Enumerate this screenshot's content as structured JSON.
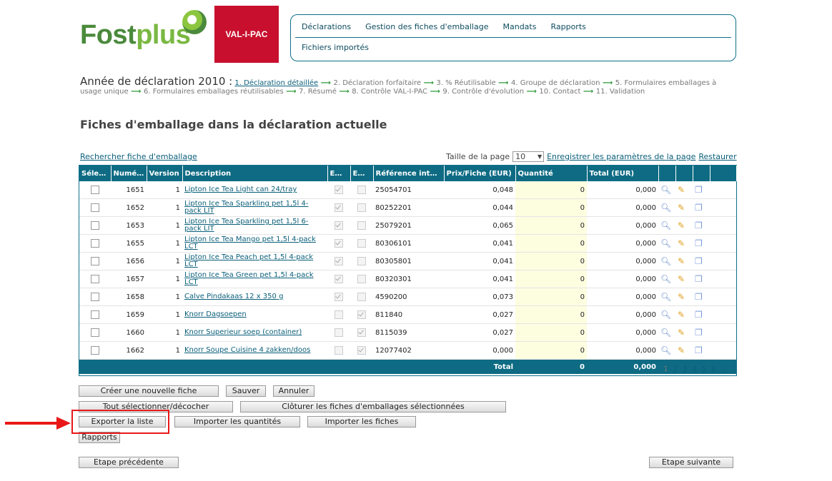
{
  "header": {
    "logo_text_a": "Fost",
    "logo_text_b": "plus",
    "partner_logo": "VAL-I-PAC"
  },
  "nav": {
    "items": [
      "Déclarations",
      "Gestion des fiches d'emballage",
      "Mandats",
      "Rapports"
    ],
    "sub_item": "Fichiers importés"
  },
  "breadcrumb": {
    "year_label": "Année de déclaration 2010 :",
    "steps": [
      "1. Déclaration détaillée",
      "2. Déclaration forfaitaire",
      "3. % Réutilisable",
      "4. Groupe de déclaration",
      "5. Formulaires emballages à usage unique",
      "6. Formulaires emballages réutilisables",
      "7. Résumé",
      "8. Contrôle VAL-I-PAC",
      "9. Contrôle d'évolution",
      "10. Contact",
      "11. Validation"
    ]
  },
  "page_title": "Fiches d'emballage dans la déclaration actuelle",
  "search_link": "Rechercher fiche d'emballage",
  "page_size": {
    "label": "Taille de la page",
    "value": "10",
    "save_link": "Enregistrer les paramètres de la page",
    "restore_link": "Restaurer"
  },
  "table": {
    "headers": [
      "Sélec...",
      "Numéro",
      "Version",
      "Description",
      "Em...",
      "Em...",
      "Référence inter...",
      "Prix/Fiche (EUR)",
      "Quantité",
      "Total (EUR)",
      "",
      "",
      "",
      ""
    ],
    "rows": [
      {
        "num": "1651",
        "ver": "1",
        "desc": "Lipton Ice Tea Light can 24/tray",
        "em1": true,
        "em2": false,
        "ref": "25054701",
        "price": "0,048",
        "qty": "0",
        "total": "0,000"
      },
      {
        "num": "1652",
        "ver": "1",
        "desc": "Lipton Ice Tea Sparkling pet 1,5l 4-pack LIT",
        "em1": true,
        "em2": false,
        "ref": "80252201",
        "price": "0,044",
        "qty": "0",
        "total": "0,000"
      },
      {
        "num": "1653",
        "ver": "1",
        "desc": "Lipton Ice Tea Sparkling pet 1,5l 6-pack LIT",
        "em1": true,
        "em2": false,
        "ref": "25079201",
        "price": "0,065",
        "qty": "0",
        "total": "0,000"
      },
      {
        "num": "1655",
        "ver": "1",
        "desc": "Lipton Ice Tea Mango pet 1,5l 4-pack LCT",
        "em1": true,
        "em2": false,
        "ref": "80306101",
        "price": "0,041",
        "qty": "0",
        "total": "0,000"
      },
      {
        "num": "1656",
        "ver": "1",
        "desc": "Lipton Ice Tea Peach pet 1,5l 4-pack LCT",
        "em1": true,
        "em2": false,
        "ref": "80305801",
        "price": "0,041",
        "qty": "0",
        "total": "0,000"
      },
      {
        "num": "1657",
        "ver": "1",
        "desc": "Lipton Ice Tea Green pet 1,5l 4-pack LCT",
        "em1": true,
        "em2": false,
        "ref": "80320301",
        "price": "0,041",
        "qty": "0",
        "total": "0,000"
      },
      {
        "num": "1658",
        "ver": "1",
        "desc": "Calve Pindakaas 12 x 350 g",
        "em1": true,
        "em2": false,
        "ref": "4590200",
        "price": "0,073",
        "qty": "0",
        "total": "0,000"
      },
      {
        "num": "1659",
        "ver": "1",
        "desc": "Knorr Dagsoepen",
        "em1": false,
        "em2": true,
        "ref": "811840",
        "price": "0,027",
        "qty": "0",
        "total": "0,000"
      },
      {
        "num": "1660",
        "ver": "1",
        "desc": "Knorr Superieur soep (container)",
        "em1": false,
        "em2": true,
        "ref": "8115039",
        "price": "0,027",
        "qty": "0",
        "total": "0,000"
      },
      {
        "num": "1662",
        "ver": "1",
        "desc": "Knorr Soupe Cuisine 4 zakken/doos",
        "em1": false,
        "em2": true,
        "ref": "12077402",
        "price": "0,000",
        "qty": "0",
        "total": "0,000"
      }
    ],
    "footer": {
      "label": "Total",
      "qty": "0",
      "total": "0,000"
    },
    "pager": [
      "1",
      "2",
      "3",
      "4",
      "5",
      "6",
      "..."
    ]
  },
  "buttons": {
    "new": "Créer une nouvelle fiche",
    "save": "Sauver",
    "cancel": "Annuler",
    "select_all": "Tout sélectionner/décocher",
    "close_selected": "Clôturer les fiches d'emballages sélectionnées",
    "export": "Exporter la liste",
    "import_qty": "Importer les quantités",
    "import_sheets": "Importer les fiches",
    "reports": "Rapports",
    "prev": "Etape précédente",
    "next": "Etape suivante"
  },
  "colors": {
    "accent": "#0e6b83",
    "highlight": "#e81818",
    "brand_red": "#c8102e",
    "brand_green": "#4a8a3c"
  }
}
